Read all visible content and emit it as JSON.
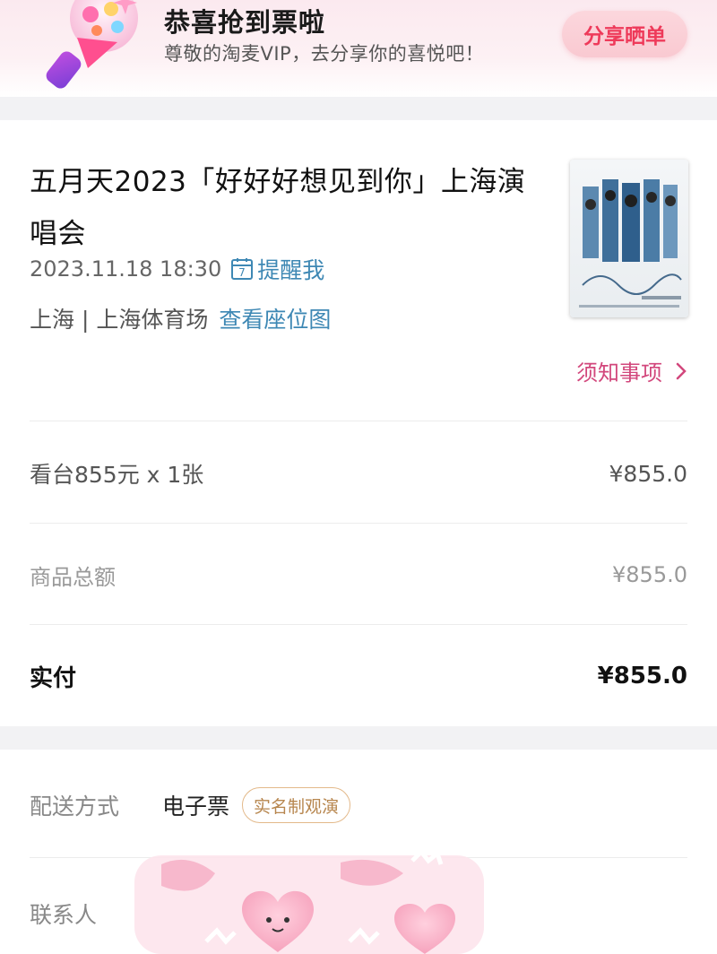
{
  "banner": {
    "title": "恭喜抢到票啦",
    "subtitle": "尊敬的淘麦VIP，去分享你的喜悦吧！",
    "share_button": "分享晒单"
  },
  "event": {
    "title": "五月天2023「好好好想见到你」上海演唱会",
    "datetime": "2023.11.18 18:30",
    "remind_link": "提醒我",
    "calendar_day": "7",
    "venue": "上海 | 上海体育场",
    "seat_map_link": "查看座位图",
    "notice_link": "须知事项"
  },
  "order": {
    "item_label": "看台855元 x 1张",
    "item_price": "¥855.0",
    "total_label": "商品总额",
    "total_value": "¥855.0",
    "paid_label": "实付",
    "paid_value": "¥855.0"
  },
  "delivery": {
    "method_label": "配送方式",
    "method_value": "电子票",
    "realname_badge": "实名制观演",
    "contact_label": "联系人"
  },
  "colors": {
    "accent_pink": "#ee3a5a",
    "link_blue": "#3e88b4",
    "notice_pink": "#d2477c",
    "badge_gold": "#b7864e"
  }
}
